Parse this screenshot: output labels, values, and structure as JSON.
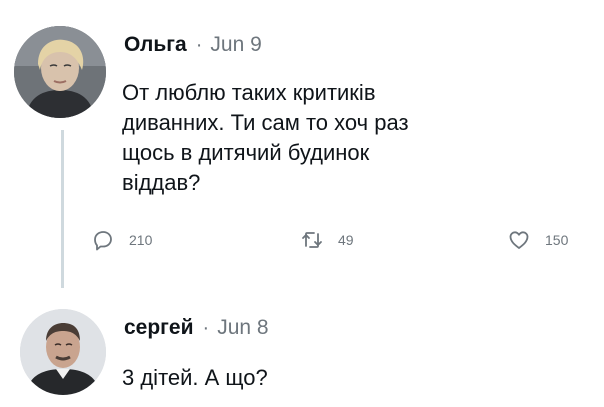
{
  "tweets": [
    {
      "author": "Ольга",
      "separator": "·",
      "date": "Jun 9",
      "text_lines": [
        "От люблю таких критиків",
        "диванних. Ти сам то хоч раз",
        "щось в дитячий будинок",
        "віддав?"
      ],
      "stats": {
        "replies": "210",
        "retweets": "49",
        "likes": "150"
      },
      "icons": {
        "reply": "reply-icon",
        "retweet": "retweet-icon",
        "like": "like-icon"
      }
    },
    {
      "author": "сергей",
      "separator": "·",
      "date": "Jun 8",
      "text_lines": [
        "3 дітей. А що?"
      ]
    }
  ],
  "colors": {
    "text": "#0f1419",
    "secondary": "#6e767d",
    "thread_line": "#cfd9de"
  }
}
